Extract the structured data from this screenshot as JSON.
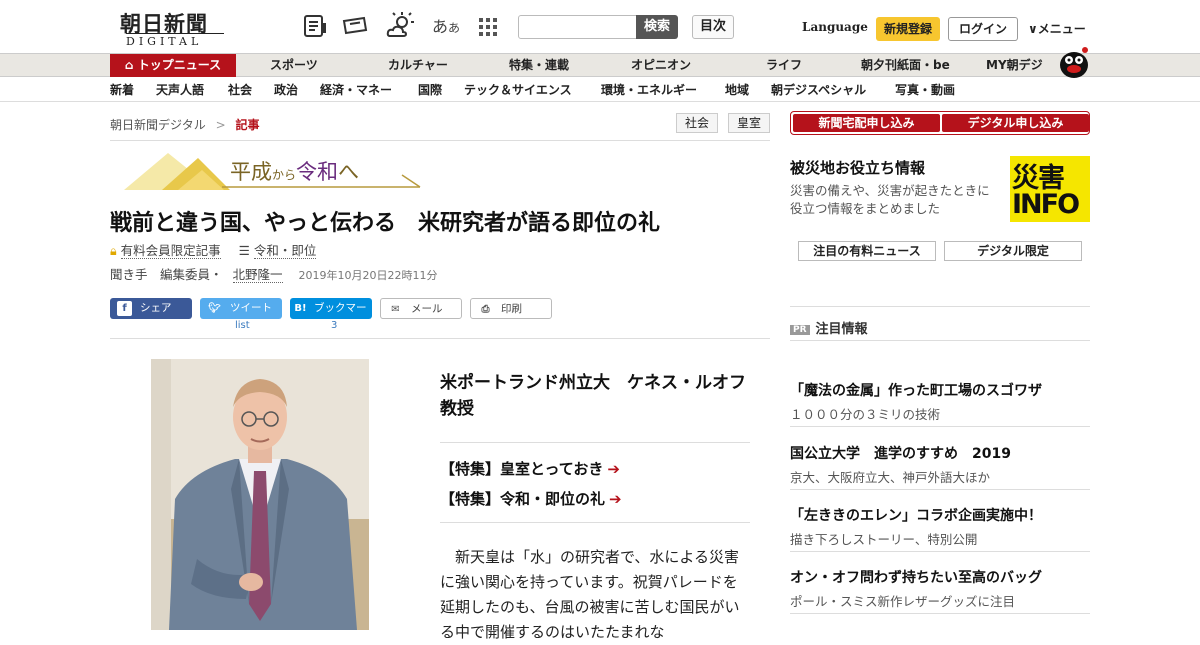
{
  "header": {
    "logo_main": "朝日新聞",
    "logo_sub": "DIGITAL",
    "aa_big": "あ",
    "aa_small": "あ",
    "search_placeholder": "",
    "search_button": "検索",
    "toc_button": "目次",
    "language": "Language",
    "register": "新規登録",
    "login": "ログイン",
    "menu": "∨メニュー"
  },
  "nav_main": [
    "トップニュース",
    "スポーツ",
    "カルチャー",
    "特集・連載",
    "オピニオン",
    "ライフ",
    "朝夕刊紙面・be",
    "MY朝デジ"
  ],
  "nav_sub": [
    "新着",
    "天声人語",
    "社会",
    "政治",
    "経済・マネー",
    "国際",
    "テック＆サイエンス",
    "環境・エネルギー",
    "地域",
    "朝デジスペシャル",
    "写真・動画"
  ],
  "breadcrumb": {
    "home": "朝日新聞デジタル",
    "sep": ">",
    "current": "記事"
  },
  "tags": [
    "社会",
    "皇室"
  ],
  "banner": {
    "part1": "平成",
    "part2": "から",
    "part3": "令和",
    "part4": "へ"
  },
  "article": {
    "title": "戦前と違う国、やっと伝わる　米研究者が語る即位の礼",
    "paid_label": "有料会員限定記事",
    "series_label": "令和・即位",
    "interviewer_label": "聞き手　編集委員・",
    "author": "北野隆一",
    "date": "2019年10月20日22時11分",
    "share": {
      "facebook": "シェア",
      "twitter": "ツイート",
      "twitter_count": "list",
      "hatena": "ブックマーク",
      "hatena_count": "3",
      "mail": "メール",
      "print": "印刷"
    },
    "subject": "米ポートランド州立大　ケネス・ルオフ教授",
    "features": [
      "【特集】皇室とっておき",
      "【特集】令和・即位の礼"
    ],
    "body": "新天皇は「水」の研究者で、水による災害に強い関心を持っています。祝賀パレードを延期したのも、台風の被害に苦しむ国民がいる中で開催するのはいたたまれな"
  },
  "sidebar": {
    "buttons": [
      "新聞宅配申し込み",
      "デジタル申し込み"
    ],
    "disaster_heading": "被災地お役立ち情報",
    "disaster_desc": "災害の備えや、災害が起きたときに役立つ情報をまとめました",
    "disaster_logo_1": "災害",
    "disaster_logo_2": "INFO",
    "pick_buttons": [
      "注目の有料ニュース",
      "デジタル限定"
    ],
    "pr_badge": "PR",
    "pr_heading": "注目情報",
    "news": [
      {
        "title": "「魔法の金属」作った町工場のスゴワザ",
        "desc": "１０００分の３ミリの技術"
      },
      {
        "title": "国公立大学　進学のすすめ　2019",
        "desc": "京大、大阪府立大、神戸外語大ほか"
      },
      {
        "title": "「左ききのエレン」コラボ企画実施中！",
        "desc": "描き下ろしストーリー、特別公開"
      },
      {
        "title": "オン・オフ問わず持ちたい至高のバッグ",
        "desc": "ポール・スミス新作レザーグッズに注目"
      }
    ]
  },
  "colors": {
    "brand_red": "#b5121b",
    "register_yellow": "#f7c62f",
    "facebook": "#3b5998",
    "twitter": "#55acee",
    "hatena": "#008fde",
    "disaster_yellow": "#f5e600"
  }
}
